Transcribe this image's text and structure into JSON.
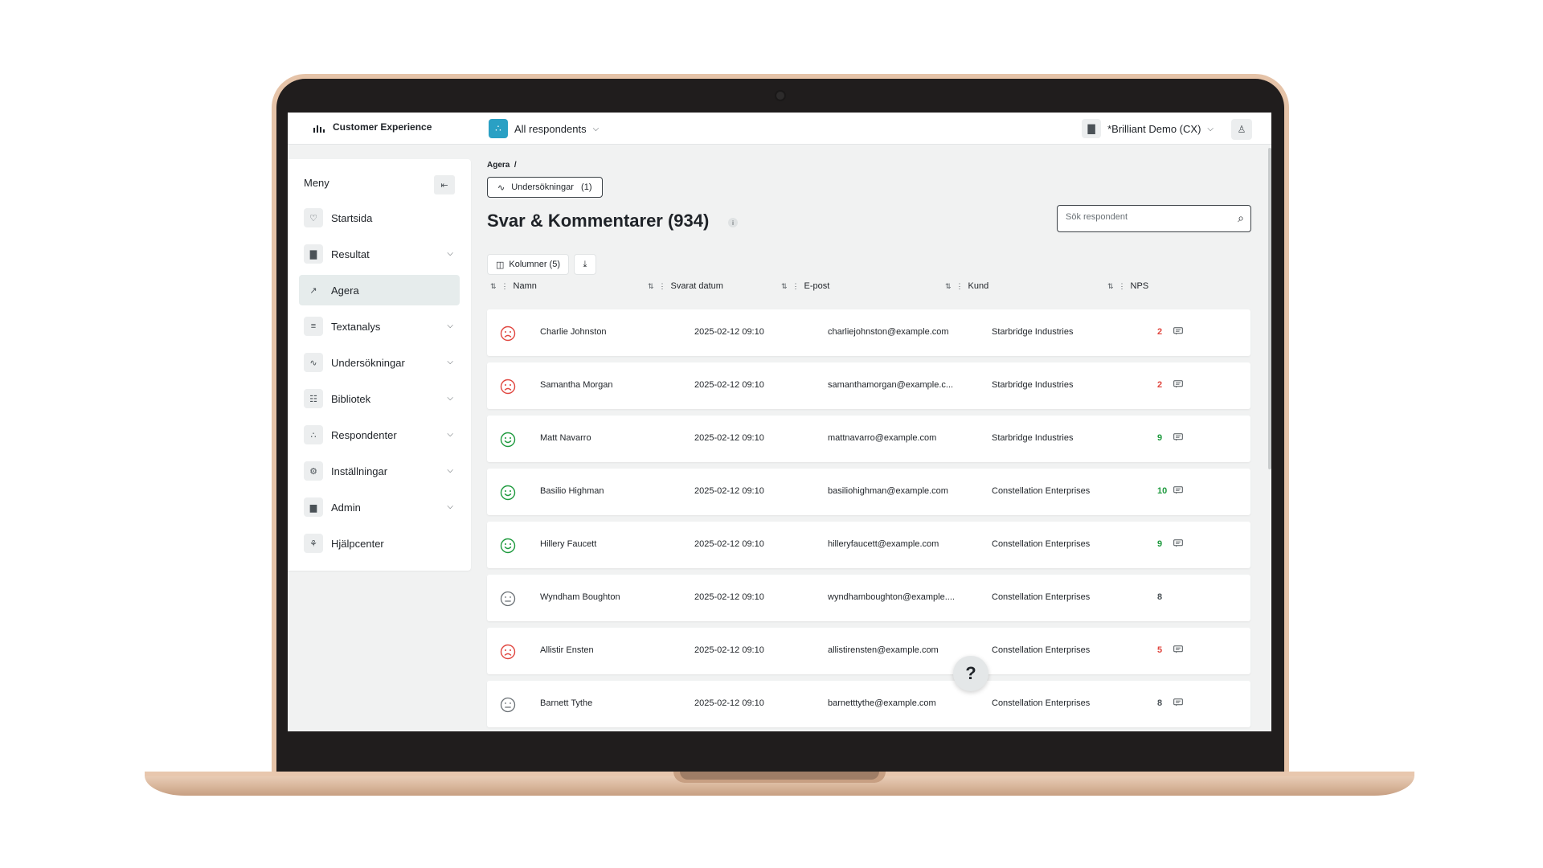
{
  "app": {
    "brand": "Customer Experience",
    "respondent_filter": "All respondents",
    "workspace": "*Brilliant Demo (CX)"
  },
  "sidebar": {
    "title": "Meny",
    "items": [
      {
        "label": "Startsida",
        "icon": "heart-icon",
        "has_children": false,
        "active": false
      },
      {
        "label": "Resultat",
        "icon": "bar-chart-icon",
        "has_children": true,
        "active": false
      },
      {
        "label": "Agera",
        "icon": "arrow-up-right-icon",
        "has_children": false,
        "active": true
      },
      {
        "label": "Textanalys",
        "icon": "layers-icon",
        "has_children": true,
        "active": false
      },
      {
        "label": "Undersökningar",
        "icon": "pulse-icon",
        "has_children": true,
        "active": false
      },
      {
        "label": "Bibliotek",
        "icon": "library-icon",
        "has_children": true,
        "active": false
      },
      {
        "label": "Respondenter",
        "icon": "org-chart-icon",
        "has_children": true,
        "active": false
      },
      {
        "label": "Inställningar",
        "icon": "gear-icon",
        "has_children": true,
        "active": false
      },
      {
        "label": "Admin",
        "icon": "building-icon",
        "has_children": true,
        "active": false
      },
      {
        "label": "Hjälpcenter",
        "icon": "help-center-icon",
        "has_children": false,
        "active": false
      }
    ]
  },
  "main": {
    "breadcrumb": "Agera  /",
    "filter_chip": "Undersökningar   (1)",
    "title": "Svar & Kommentarer (934)",
    "search_placeholder": "Sök respondent",
    "columns_button": "Kolumner (5)",
    "headers": [
      "Namn",
      "Svarat datum",
      "E-post",
      "Kund",
      "NPS"
    ],
    "rows": [
      {
        "sentiment": "negative",
        "name": "Charlie Johnston",
        "date": "2025-02-12 09:10",
        "email": "charliejohnston@example.com",
        "customer": "Starbridge Industries",
        "nps": "2",
        "comment": true
      },
      {
        "sentiment": "negative",
        "name": "Samantha Morgan",
        "date": "2025-02-12 09:10",
        "email": "samanthamorgan@example.c...",
        "customer": "Starbridge Industries",
        "nps": "2",
        "comment": true
      },
      {
        "sentiment": "positive",
        "name": "Matt Navarro",
        "date": "2025-02-12 09:10",
        "email": "mattnavarro@example.com",
        "customer": "Starbridge Industries",
        "nps": "9",
        "comment": true
      },
      {
        "sentiment": "positive",
        "name": "Basilio Highman",
        "date": "2025-02-12 09:10",
        "email": "basiliohighman@example.com",
        "customer": "Constellation Enterprises",
        "nps": "10",
        "comment": true
      },
      {
        "sentiment": "positive",
        "name": "Hillery Faucett",
        "date": "2025-02-12 09:10",
        "email": "hilleryfaucett@example.com",
        "customer": "Constellation Enterprises",
        "nps": "9",
        "comment": true
      },
      {
        "sentiment": "neutral",
        "name": "Wyndham Boughton",
        "date": "2025-02-12 09:10",
        "email": "wyndhamboughton@example....",
        "customer": "Constellation Enterprises",
        "nps": "8",
        "comment": false
      },
      {
        "sentiment": "negative",
        "name": "Allistir Ensten",
        "date": "2025-02-12 09:10",
        "email": "allistirensten@example.com",
        "customer": "Constellation Enterprises",
        "nps": "5",
        "comment": true
      },
      {
        "sentiment": "neutral",
        "name": "Barnett Tythe",
        "date": "2025-02-12 09:10",
        "email": "barnetttythe@example.com",
        "customer": "Constellation Enterprises",
        "nps": "8",
        "comment": true
      }
    ]
  },
  "help_button": "?",
  "colors": {
    "negative": "#e0463f",
    "positive": "#1e9a3e",
    "neutral": "#6b7176",
    "accent": "#2aa0c4",
    "laptop": "#e5c3a8"
  }
}
